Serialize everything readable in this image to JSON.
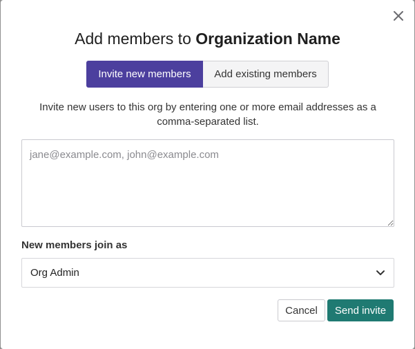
{
  "dialog": {
    "title_prefix": "Add members to ",
    "title_org": "Organization Name",
    "close_icon": "close-icon"
  },
  "tabs": [
    {
      "label": "Invite new members",
      "active": true
    },
    {
      "label": "Add existing members",
      "active": false
    }
  ],
  "description": "Invite new users to this org by entering one or more email addresses as a comma-separated list.",
  "emails_field": {
    "value": "",
    "placeholder": "jane@example.com, john@example.com"
  },
  "role": {
    "label": "New members join as",
    "selected": "Org Admin",
    "icon": "chevron-down-icon"
  },
  "actions": {
    "cancel_label": "Cancel",
    "send_label": "Send invite"
  },
  "colors": {
    "tab_active": "#4c3f9e",
    "primary_button": "#1f7a72"
  }
}
